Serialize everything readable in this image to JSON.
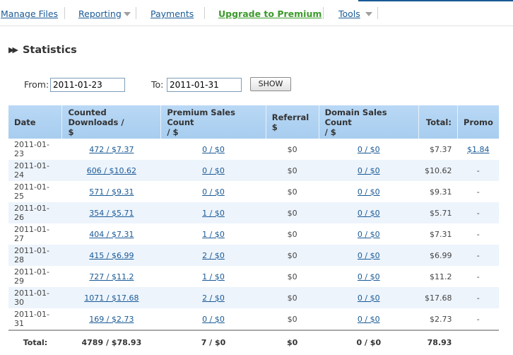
{
  "nav": {
    "items": [
      {
        "label": "Manage Files"
      },
      {
        "label": "Reporting"
      },
      {
        "label": "Payments"
      },
      {
        "label": "Upgrade to Premium"
      },
      {
        "label": "Tools"
      }
    ]
  },
  "heading": {
    "title": "Statistics"
  },
  "filter": {
    "from_label": "From:",
    "from_value": "2011-01-23",
    "to_label": "To:",
    "to_value": "2011-01-31",
    "show_label": "SHOW"
  },
  "table": {
    "headers": [
      {
        "line1": "Date",
        "line2": ""
      },
      {
        "line1": "Counted Downloads /",
        "line2": "$"
      },
      {
        "line1": "Premium Sales Count",
        "line2": "/ $"
      },
      {
        "line1": "Referral",
        "line2": "$"
      },
      {
        "line1": "Domain Sales Count",
        "line2": "/ $"
      },
      {
        "line1": "Total:",
        "line2": ""
      },
      {
        "line1": "Promo",
        "line2": ""
      }
    ],
    "rows": [
      {
        "date": "2011-01-23",
        "downloads": "472 / $7.37",
        "premium": "0 / $0",
        "referral": "$0",
        "domain": "0 / $0",
        "total": "$7.37",
        "promo": "$1.84"
      },
      {
        "date": "2011-01-24",
        "downloads": "606 / $10.62",
        "premium": "0 / $0",
        "referral": "$0",
        "domain": "0 / $0",
        "total": "$10.62",
        "promo": "-"
      },
      {
        "date": "2011-01-25",
        "downloads": "571 / $9.31",
        "premium": "0 / $0",
        "referral": "$0",
        "domain": "0 / $0",
        "total": "$9.31",
        "promo": "-"
      },
      {
        "date": "2011-01-26",
        "downloads": "354 / $5.71",
        "premium": "1 / $0",
        "referral": "$0",
        "domain": "0 / $0",
        "total": "$5.71",
        "promo": "-"
      },
      {
        "date": "2011-01-27",
        "downloads": "404 / $7.31",
        "premium": "1 / $0",
        "referral": "$0",
        "domain": "0 / $0",
        "total": "$7.31",
        "promo": "-"
      },
      {
        "date": "2011-01-28",
        "downloads": "415 / $6.99",
        "premium": "2 / $0",
        "referral": "$0",
        "domain": "0 / $0",
        "total": "$6.99",
        "promo": "-"
      },
      {
        "date": "2011-01-29",
        "downloads": "727 / $11.2",
        "premium": "1 / $0",
        "referral": "$0",
        "domain": "0 / $0",
        "total": "$11.2",
        "promo": "-"
      },
      {
        "date": "2011-01-30",
        "downloads": "1071 / $17.68",
        "premium": "2 / $0",
        "referral": "$0",
        "domain": "0 / $0",
        "total": "$17.68",
        "promo": "-"
      },
      {
        "date": "2011-01-31",
        "downloads": "169 / $2.73",
        "premium": "0 / $0",
        "referral": "$0",
        "domain": "0 / $0",
        "total": "$2.73",
        "promo": "-"
      }
    ],
    "totals": {
      "label": "Total:",
      "downloads": "4789 / $78.93",
      "premium": "7 / $0",
      "referral": "$0",
      "domain": "0 / $0",
      "total": "78.93"
    }
  },
  "colors": {
    "link": "#1a5a96",
    "upgrade": "#3c9a2c",
    "header_bg": "#b1d3f2",
    "row_alt": "#edf4fc"
  }
}
